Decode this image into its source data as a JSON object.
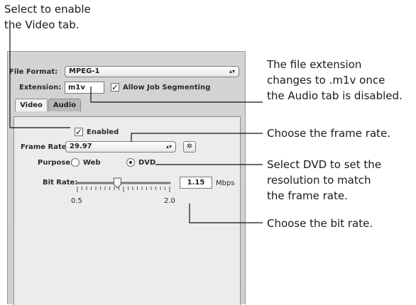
{
  "callouts": {
    "enable_video": [
      "Select to enable",
      "the Video tab."
    ],
    "extension": [
      "The file extension",
      "changes to .m1v once",
      "the Audio tab is disabled."
    ],
    "frame_rate": "Choose the frame rate.",
    "dvd": [
      "Select DVD to set the",
      "resolution to match",
      "the frame rate."
    ],
    "bit_rate": "Choose the bit rate."
  },
  "settings": {
    "file_format_label": "File Format:",
    "file_format_value": "MPEG-1",
    "extension_label": "Extension:",
    "extension_value": "m1v",
    "allow_job_segmenting_label": "Allow Job Segmenting",
    "allow_job_segmenting_checked": true,
    "tabs": [
      {
        "label": "Video",
        "active": true
      },
      {
        "label": "Audio",
        "active": false
      }
    ],
    "enabled_label": "Enabled",
    "enabled_checked": true,
    "frame_rate_label": "Frame Rate:",
    "frame_rate_value": "29.97",
    "purpose_label": "Purpose:",
    "purpose_options": [
      "Web",
      "DVD"
    ],
    "purpose_selected": "DVD",
    "bit_rate_label": "Bit Rate:",
    "bit_rate_value": "1.15",
    "bit_rate_unit": "Mbps",
    "slider_min_label": "0.5",
    "slider_max_label": "2.0",
    "slider_min": 0.5,
    "slider_max": 2.0,
    "slider_value": 1.15
  }
}
